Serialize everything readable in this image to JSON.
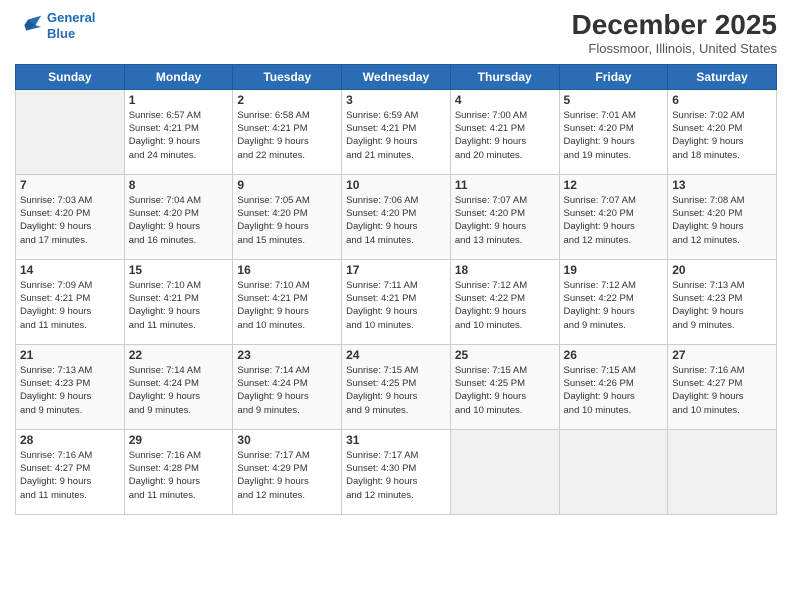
{
  "logo": {
    "line1": "General",
    "line2": "Blue"
  },
  "header": {
    "month": "December 2025",
    "location": "Flossmoor, Illinois, United States"
  },
  "weekdays": [
    "Sunday",
    "Monday",
    "Tuesday",
    "Wednesday",
    "Thursday",
    "Friday",
    "Saturday"
  ],
  "weeks": [
    [
      {
        "day": "",
        "info": ""
      },
      {
        "day": "1",
        "info": "Sunrise: 6:57 AM\nSunset: 4:21 PM\nDaylight: 9 hours\nand 24 minutes."
      },
      {
        "day": "2",
        "info": "Sunrise: 6:58 AM\nSunset: 4:21 PM\nDaylight: 9 hours\nand 22 minutes."
      },
      {
        "day": "3",
        "info": "Sunrise: 6:59 AM\nSunset: 4:21 PM\nDaylight: 9 hours\nand 21 minutes."
      },
      {
        "day": "4",
        "info": "Sunrise: 7:00 AM\nSunset: 4:21 PM\nDaylight: 9 hours\nand 20 minutes."
      },
      {
        "day": "5",
        "info": "Sunrise: 7:01 AM\nSunset: 4:20 PM\nDaylight: 9 hours\nand 19 minutes."
      },
      {
        "day": "6",
        "info": "Sunrise: 7:02 AM\nSunset: 4:20 PM\nDaylight: 9 hours\nand 18 minutes."
      }
    ],
    [
      {
        "day": "7",
        "info": "Sunrise: 7:03 AM\nSunset: 4:20 PM\nDaylight: 9 hours\nand 17 minutes."
      },
      {
        "day": "8",
        "info": "Sunrise: 7:04 AM\nSunset: 4:20 PM\nDaylight: 9 hours\nand 16 minutes."
      },
      {
        "day": "9",
        "info": "Sunrise: 7:05 AM\nSunset: 4:20 PM\nDaylight: 9 hours\nand 15 minutes."
      },
      {
        "day": "10",
        "info": "Sunrise: 7:06 AM\nSunset: 4:20 PM\nDaylight: 9 hours\nand 14 minutes."
      },
      {
        "day": "11",
        "info": "Sunrise: 7:07 AM\nSunset: 4:20 PM\nDaylight: 9 hours\nand 13 minutes."
      },
      {
        "day": "12",
        "info": "Sunrise: 7:07 AM\nSunset: 4:20 PM\nDaylight: 9 hours\nand 12 minutes."
      },
      {
        "day": "13",
        "info": "Sunrise: 7:08 AM\nSunset: 4:20 PM\nDaylight: 9 hours\nand 12 minutes."
      }
    ],
    [
      {
        "day": "14",
        "info": "Sunrise: 7:09 AM\nSunset: 4:21 PM\nDaylight: 9 hours\nand 11 minutes."
      },
      {
        "day": "15",
        "info": "Sunrise: 7:10 AM\nSunset: 4:21 PM\nDaylight: 9 hours\nand 11 minutes."
      },
      {
        "day": "16",
        "info": "Sunrise: 7:10 AM\nSunset: 4:21 PM\nDaylight: 9 hours\nand 10 minutes."
      },
      {
        "day": "17",
        "info": "Sunrise: 7:11 AM\nSunset: 4:21 PM\nDaylight: 9 hours\nand 10 minutes."
      },
      {
        "day": "18",
        "info": "Sunrise: 7:12 AM\nSunset: 4:22 PM\nDaylight: 9 hours\nand 10 minutes."
      },
      {
        "day": "19",
        "info": "Sunrise: 7:12 AM\nSunset: 4:22 PM\nDaylight: 9 hours\nand 9 minutes."
      },
      {
        "day": "20",
        "info": "Sunrise: 7:13 AM\nSunset: 4:23 PM\nDaylight: 9 hours\nand 9 minutes."
      }
    ],
    [
      {
        "day": "21",
        "info": "Sunrise: 7:13 AM\nSunset: 4:23 PM\nDaylight: 9 hours\nand 9 minutes."
      },
      {
        "day": "22",
        "info": "Sunrise: 7:14 AM\nSunset: 4:24 PM\nDaylight: 9 hours\nand 9 minutes."
      },
      {
        "day": "23",
        "info": "Sunrise: 7:14 AM\nSunset: 4:24 PM\nDaylight: 9 hours\nand 9 minutes."
      },
      {
        "day": "24",
        "info": "Sunrise: 7:15 AM\nSunset: 4:25 PM\nDaylight: 9 hours\nand 9 minutes."
      },
      {
        "day": "25",
        "info": "Sunrise: 7:15 AM\nSunset: 4:25 PM\nDaylight: 9 hours\nand 10 minutes."
      },
      {
        "day": "26",
        "info": "Sunrise: 7:15 AM\nSunset: 4:26 PM\nDaylight: 9 hours\nand 10 minutes."
      },
      {
        "day": "27",
        "info": "Sunrise: 7:16 AM\nSunset: 4:27 PM\nDaylight: 9 hours\nand 10 minutes."
      }
    ],
    [
      {
        "day": "28",
        "info": "Sunrise: 7:16 AM\nSunset: 4:27 PM\nDaylight: 9 hours\nand 11 minutes."
      },
      {
        "day": "29",
        "info": "Sunrise: 7:16 AM\nSunset: 4:28 PM\nDaylight: 9 hours\nand 11 minutes."
      },
      {
        "day": "30",
        "info": "Sunrise: 7:17 AM\nSunset: 4:29 PM\nDaylight: 9 hours\nand 12 minutes."
      },
      {
        "day": "31",
        "info": "Sunrise: 7:17 AM\nSunset: 4:30 PM\nDaylight: 9 hours\nand 12 minutes."
      },
      {
        "day": "",
        "info": ""
      },
      {
        "day": "",
        "info": ""
      },
      {
        "day": "",
        "info": ""
      }
    ]
  ]
}
